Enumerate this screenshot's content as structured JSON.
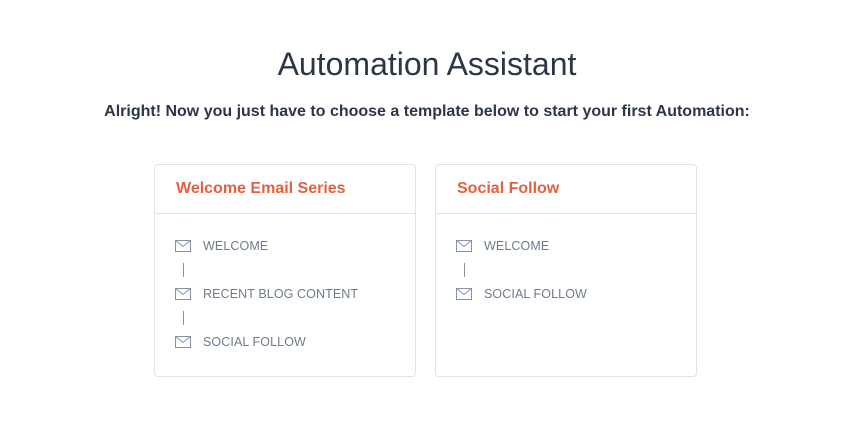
{
  "header": {
    "title": "Automation Assistant",
    "subtitle": "Alright! Now you just have to choose a template below to start your first Automation:"
  },
  "templates": [
    {
      "title": "Welcome Email Series",
      "steps": [
        {
          "icon": "envelope-icon",
          "label": "WELCOME"
        },
        {
          "icon": "envelope-icon",
          "label": "RECENT BLOG CONTENT"
        },
        {
          "icon": "envelope-icon",
          "label": "SOCIAL FOLLOW"
        }
      ]
    },
    {
      "title": "Social Follow",
      "steps": [
        {
          "icon": "envelope-icon",
          "label": "WELCOME"
        },
        {
          "icon": "envelope-icon",
          "label": "SOCIAL FOLLOW"
        }
      ]
    }
  ],
  "colors": {
    "heading": "#2b3648",
    "accent": "#e5603f",
    "muted": "#6b7b93",
    "border": "#dfe3e8"
  }
}
